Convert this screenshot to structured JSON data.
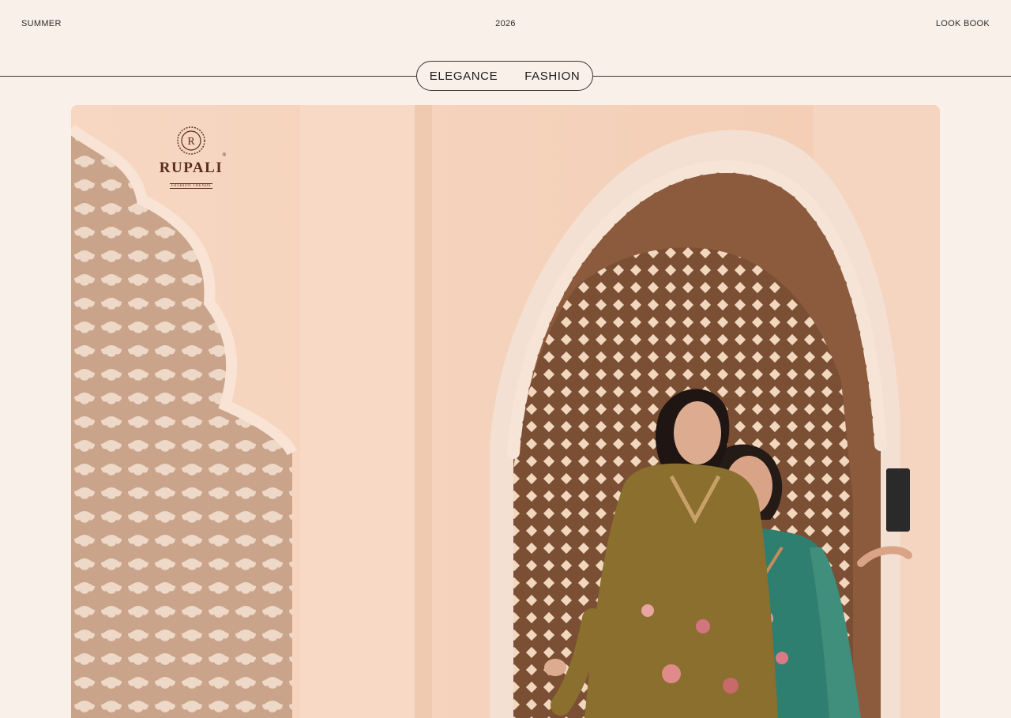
{
  "header": {
    "left": "SUMMER",
    "center": "2026",
    "right": "LOOK BOOK"
  },
  "tagline": {
    "word1": "ELEGANCE",
    "word2": "FASHION"
  },
  "brand": {
    "monogram": "R",
    "name": "RUPALI",
    "sub": "FASHION TRENDS",
    "tm": "®"
  },
  "colors": {
    "page_bg": "#f9f0ea",
    "wall": "#f5d3bd",
    "lattice": "#a07050",
    "brand": "#5a2d1c",
    "kurta_olive": "#8a6f2e",
    "kurta_teal": "#2f7f70"
  }
}
